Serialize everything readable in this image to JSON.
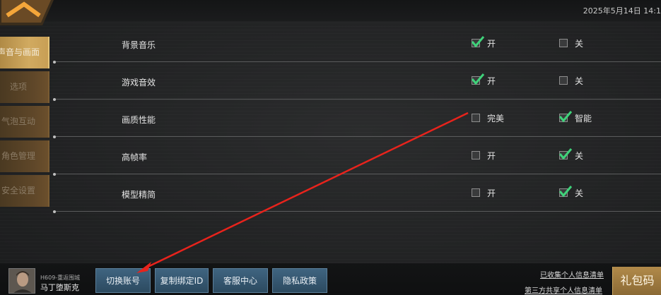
{
  "header": {
    "datetime": "2025年5月14日  14:1"
  },
  "sidebar": {
    "items": [
      {
        "label": "声音与画面",
        "active": true
      },
      {
        "label": "选项",
        "active": false
      },
      {
        "label": "气泡互动",
        "active": false
      },
      {
        "label": "角色管理",
        "active": false
      },
      {
        "label": "安全设置",
        "active": false
      }
    ]
  },
  "settings": {
    "rows": [
      {
        "label": "背景音乐",
        "option_a": "开",
        "option_b": "关",
        "a_checked": true,
        "b_checked": false
      },
      {
        "label": "游戏音效",
        "option_a": "开",
        "option_b": "关",
        "a_checked": true,
        "b_checked": false
      },
      {
        "label": "画质性能",
        "option_a": "完美",
        "option_b": "智能",
        "a_checked": false,
        "b_checked": true
      },
      {
        "label": "高帧率",
        "option_a": "开",
        "option_b": "关",
        "a_checked": false,
        "b_checked": true
      },
      {
        "label": "模型精简",
        "option_a": "开",
        "option_b": "关",
        "a_checked": false,
        "b_checked": true
      }
    ]
  },
  "footer": {
    "server": "H609-重返围城",
    "username": "马丁堕斯克",
    "buttons": [
      "切换账号",
      "复制绑定ID",
      "客服中心",
      "隐私政策"
    ],
    "link_collected": "已收集个人信息清单",
    "link_third_party": "第三方共享个人信息清单",
    "gift_code": "礼包码"
  },
  "colors": {
    "check_green": "#3fd27a",
    "accent_gold": "#c89f55",
    "button_blue": "#33566f",
    "annotation_red": "#e8231c"
  }
}
